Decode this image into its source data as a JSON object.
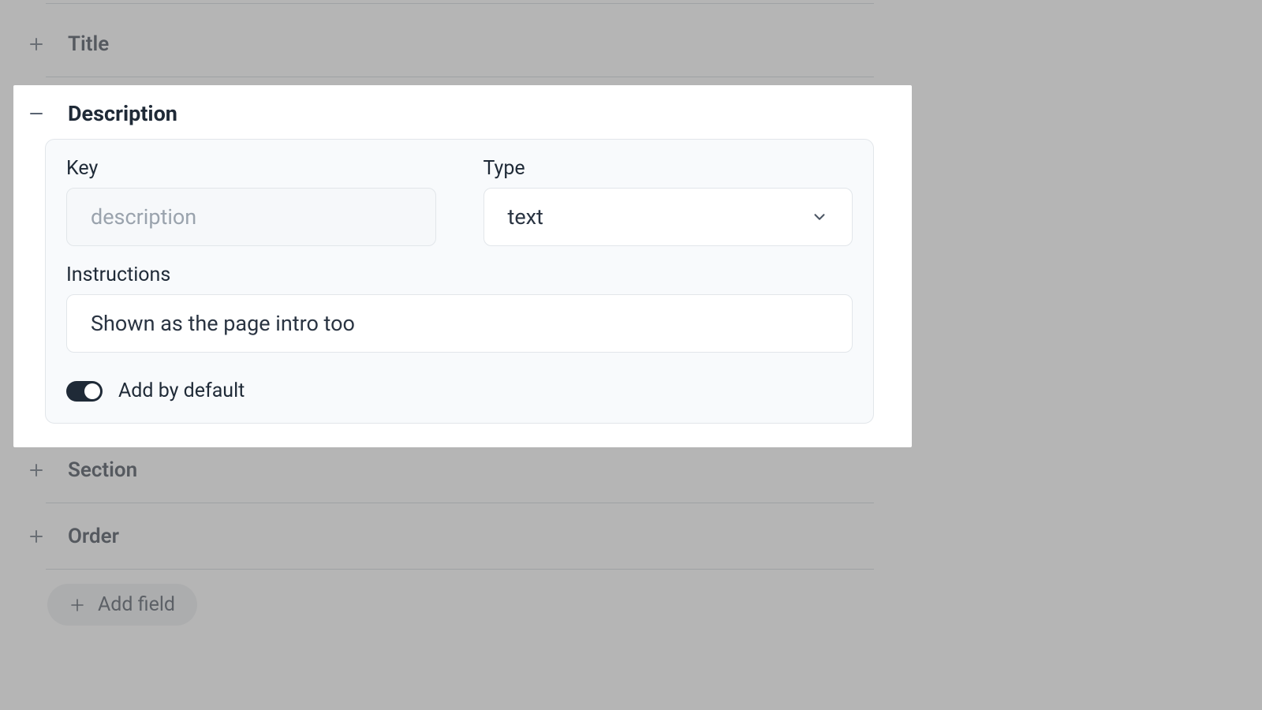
{
  "fields": [
    {
      "name": "Title"
    },
    {
      "name": "Description"
    },
    {
      "name": "Section"
    },
    {
      "name": "Order"
    }
  ],
  "expanded": {
    "title": "Description",
    "key_label": "Key",
    "key_value": "description",
    "type_label": "Type",
    "type_value": "text",
    "instructions_label": "Instructions",
    "instructions_value": "Shown as the page intro too",
    "toggle_label": "Add by default",
    "toggle_on": true
  },
  "add_field_label": "Add field"
}
